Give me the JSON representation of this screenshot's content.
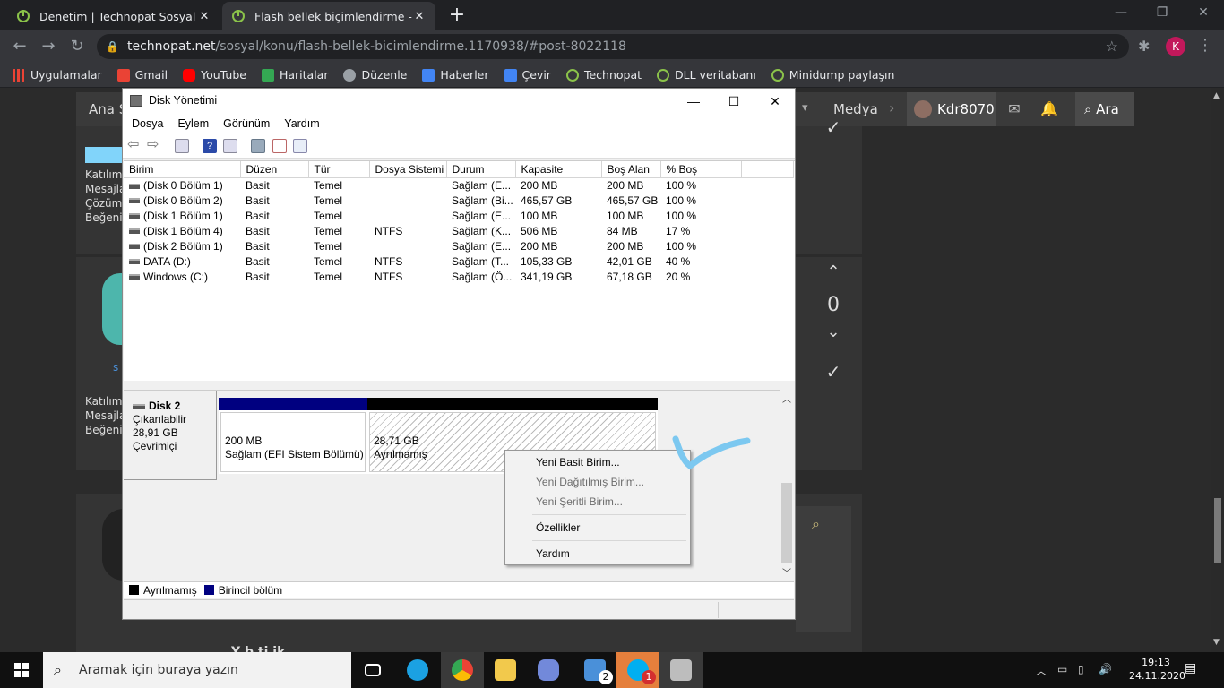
{
  "browser": {
    "tabs": [
      {
        "title": "Denetim | Technopat Sosyal"
      },
      {
        "title": "Flash bellek biçimlendirme - Technopat Sosyal"
      }
    ],
    "url_host": "technopat.net",
    "url_path": "/sosyal/konu/flash-bellek-bicimlendirme.1170938/#post-8022118",
    "profile_initial": "K",
    "bookmarks": [
      "Uygulamalar",
      "Gmail",
      "YouTube",
      "Haritalar",
      "Düzenle",
      "Haberler",
      "Çevir",
      "Technopat",
      "DLL veritabanı",
      "Minidump paylaşın"
    ]
  },
  "site": {
    "nav_home": "Ana S",
    "nav_medya": "Medya",
    "username": "Kdr8070",
    "search_label": "Ara",
    "post1_meta": [
      "Katılım:",
      "Mesajla",
      "Çözüml",
      "Beğenile"
    ],
    "post2_meta": [
      "Katılım:",
      "Mesajla",
      "Beğenile"
    ],
    "post2_letter": "s",
    "vote_count": "0",
    "bottom_text": "Y      b    ti ik"
  },
  "disk_mgmt": {
    "title": "Disk Yönetimi",
    "menu": [
      "Dosya",
      "Eylem",
      "Görünüm",
      "Yardım"
    ],
    "columns": [
      "Birim",
      "Düzen",
      "Tür",
      "Dosya Sistemi",
      "Durum",
      "Kapasite",
      "Boş Alan",
      "% Boş"
    ],
    "rows": [
      [
        "(Disk 0 Bölüm 1)",
        "Basit",
        "Temel",
        "",
        "Sağlam (E...",
        "200 MB",
        "200 MB",
        "100 %"
      ],
      [
        "(Disk 0 Bölüm 2)",
        "Basit",
        "Temel",
        "",
        "Sağlam (Bi...",
        "465,57 GB",
        "465,57 GB",
        "100 %"
      ],
      [
        "(Disk 1 Bölüm 1)",
        "Basit",
        "Temel",
        "",
        "Sağlam (E...",
        "100 MB",
        "100 MB",
        "100 %"
      ],
      [
        "(Disk 1 Bölüm 4)",
        "Basit",
        "Temel",
        "NTFS",
        "Sağlam (K...",
        "506 MB",
        "84 MB",
        "17 %"
      ],
      [
        "(Disk 2 Bölüm 1)",
        "Basit",
        "Temel",
        "",
        "Sağlam (E...",
        "200 MB",
        "200 MB",
        "100 %"
      ],
      [
        "DATA (D:)",
        "Basit",
        "Temel",
        "NTFS",
        "Sağlam (T...",
        "105,33 GB",
        "42,01 GB",
        "40 %"
      ],
      [
        "Windows (C:)",
        "Basit",
        "Temel",
        "NTFS",
        "Sağlam (Ö...",
        "341,19 GB",
        "67,18 GB",
        "20 %"
      ]
    ],
    "disk": {
      "name": "Disk 2",
      "type": "Çıkarılabilir",
      "size": "28,91 GB",
      "status": "Çevrimiçi"
    },
    "partitions": [
      {
        "size": "200 MB",
        "label": "Sağlam (EFI Sistem Bölümü)",
        "color": "#000080"
      },
      {
        "size": "28,71 GB",
        "label": "Ayrılmamış",
        "color": "#000000"
      }
    ],
    "legend": [
      {
        "label": "Ayrılmamış",
        "color": "#000000"
      },
      {
        "label": "Birincil bölüm",
        "color": "#000080"
      }
    ]
  },
  "context_menu": {
    "items": [
      {
        "label": "Yeni Basit Birim...",
        "enabled": true
      },
      {
        "label": "Yeni Dağıtılmış Birim...",
        "enabled": false
      },
      {
        "label": "Yeni Şeritli Birim...",
        "enabled": false
      },
      {
        "label": "Özellikler",
        "enabled": true
      },
      {
        "label": "Yardım",
        "enabled": true
      }
    ]
  },
  "taskbar": {
    "search_placeholder": "Aramak için buraya yazın",
    "time": "19:13",
    "date": "24.11.2020",
    "mail_badge": "2",
    "skype_badge": "1"
  }
}
